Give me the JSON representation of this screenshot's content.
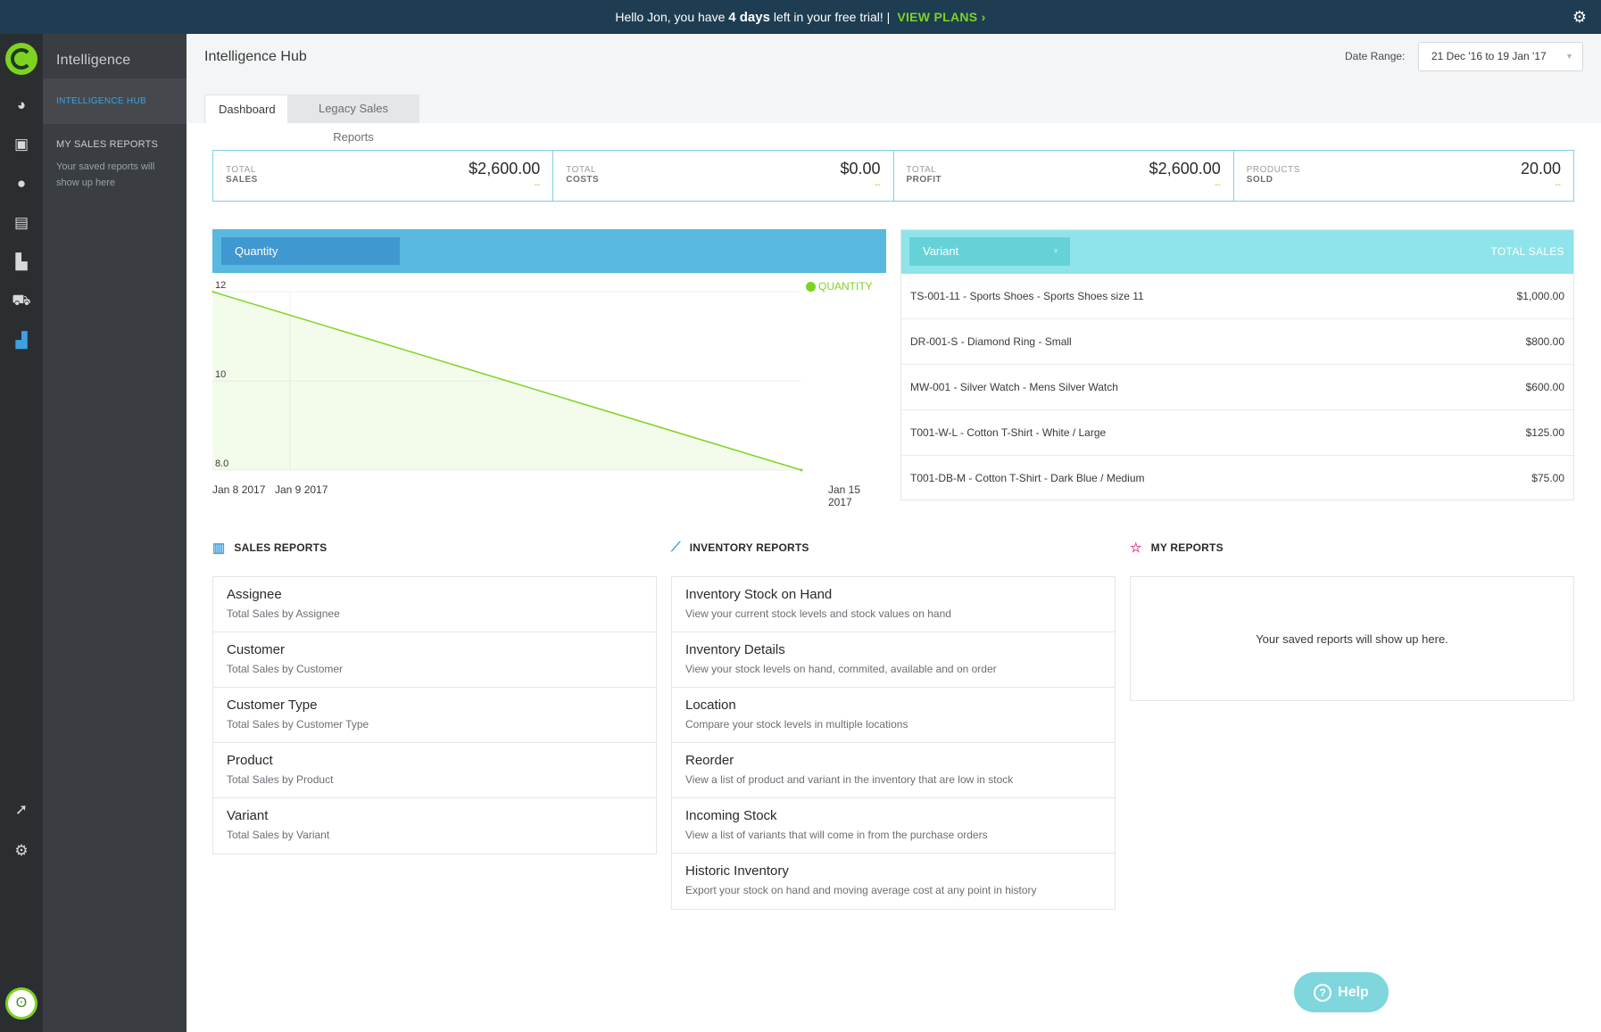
{
  "topbar": {
    "greeting_pre": "Hello Jon, you have ",
    "days": "4 days",
    "greeting_post": " left in your free trial! |",
    "view_plans": "VIEW PLANS",
    "chevron": "›",
    "gear_icon": "gear-icon"
  },
  "sidebar": {
    "app_name": "Intelligence",
    "hub_item": "INTELLIGENCE HUB",
    "my_reports_heading": "MY SALES REPORTS",
    "my_reports_empty": "Your saved reports will show up here"
  },
  "header": {
    "title": "Intelligence Hub",
    "date_range_label": "Date Range:",
    "date_range_value": "21 Dec '16 to 19 Jan '17",
    "tabs": [
      "Dashboard",
      "Legacy Sales Reports"
    ]
  },
  "stats": [
    {
      "line1": "TOTAL",
      "line2": "SALES",
      "value": "$2,600.00",
      "delta": "--"
    },
    {
      "line1": "TOTAL",
      "line2": "COSTS",
      "value": "$0.00",
      "delta": "--"
    },
    {
      "line1": "TOTAL",
      "line2": "PROFIT",
      "value": "$2,600.00",
      "delta": "--"
    },
    {
      "line1": "PRODUCTS",
      "line2": "SOLD",
      "value": "20.00",
      "delta": "--"
    }
  ],
  "chart_selector": "Quantity",
  "chart_data": {
    "type": "area",
    "x": [
      "Jan 8 2017",
      "Jan 15 2017"
    ],
    "series": [
      {
        "name": "QUANTITY",
        "values": [
          12,
          8.0
        ]
      }
    ],
    "y_ticks": [
      "12",
      "10",
      "8.0"
    ],
    "x_ticks": [
      "Jan 8 2017",
      "Jan 9 2017",
      "Jan 15 2017"
    ],
    "ylim": [
      8,
      12
    ],
    "color": "#7ed321",
    "grid": true,
    "legend": "top-right"
  },
  "variant_table": {
    "selector": "Variant",
    "column": "TOTAL SALES",
    "rows": [
      {
        "name": "TS-001-11 - Sports Shoes - Sports Shoes size 11",
        "amount": "$1,000.00"
      },
      {
        "name": "DR-001-S - Diamond Ring - Small",
        "amount": "$800.00"
      },
      {
        "name": "MW-001 - Silver Watch - Mens Silver Watch",
        "amount": "$600.00"
      },
      {
        "name": "T001-W-L - Cotton T-Shirt - White / Large",
        "amount": "$125.00"
      },
      {
        "name": "T001-DB-M - Cotton T-Shirt - Dark Blue / Medium",
        "amount": "$75.00"
      }
    ]
  },
  "sales_reports": {
    "heading": "SALES REPORTS",
    "items": [
      {
        "title": "Assignee",
        "desc": "Total Sales by Assignee"
      },
      {
        "title": "Customer",
        "desc": "Total Sales by Customer"
      },
      {
        "title": "Customer Type",
        "desc": "Total Sales by Customer Type"
      },
      {
        "title": "Product",
        "desc": "Total Sales by Product"
      },
      {
        "title": "Variant",
        "desc": "Total Sales by Variant"
      }
    ]
  },
  "inventory_reports": {
    "heading": "INVENTORY REPORTS",
    "items": [
      {
        "title": "Inventory Stock on Hand",
        "desc": "View your current stock levels and stock values on hand"
      },
      {
        "title": "Inventory Details",
        "desc": "View your stock levels on hand, commited, available and on order"
      },
      {
        "title": "Location",
        "desc": "Compare your stock levels in multiple locations"
      },
      {
        "title": "Reorder",
        "desc": "View a list of product and variant in the inventory that are low in stock"
      },
      {
        "title": "Incoming Stock",
        "desc": "View a list of variants that will come in from the purchase orders"
      },
      {
        "title": "Historic Inventory",
        "desc": "Export your stock on hand and moving average cost at any point in history"
      }
    ]
  },
  "my_reports": {
    "heading": "MY REPORTS",
    "empty": "Your saved reports will show up here."
  },
  "help_button": "Help",
  "colors": {
    "accent": "#3ea0e0",
    "brand": "#7ed321",
    "topbar": "#1e3d52"
  }
}
